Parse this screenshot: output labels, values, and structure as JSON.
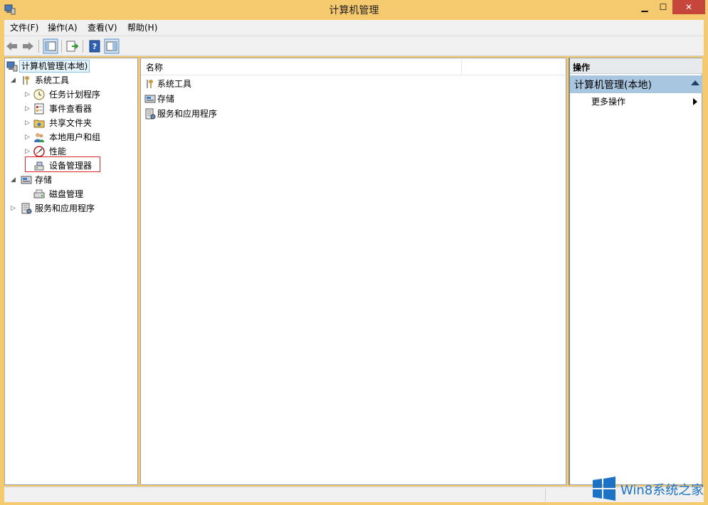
{
  "window": {
    "title": "计算机管理"
  },
  "menu": [
    "文件(F)",
    "操作(A)",
    "查看(V)",
    "帮助(H)"
  ],
  "tree": {
    "root": "计算机管理(本地)",
    "system_tools": "系统工具",
    "task_scheduler": "任务计划程序",
    "event_viewer": "事件查看器",
    "shared_folders": "共享文件夹",
    "local_users": "本地用户和组",
    "performance": "性能",
    "device_manager": "设备管理器",
    "storage": "存储",
    "disk_management": "磁盘管理",
    "services_apps": "服务和应用程序"
  },
  "list": {
    "column_name": "名称",
    "items": [
      "系统工具",
      "存储",
      "服务和应用程序"
    ]
  },
  "actions": {
    "header": "操作",
    "section": "计算机管理(本地)",
    "more": "更多操作"
  },
  "watermark": "Win8系统之家",
  "colors": {
    "titlebar": "#f5c96e",
    "close": "#c7463b",
    "action_section": "#a9c6e0",
    "highlight": "#d9262c"
  }
}
